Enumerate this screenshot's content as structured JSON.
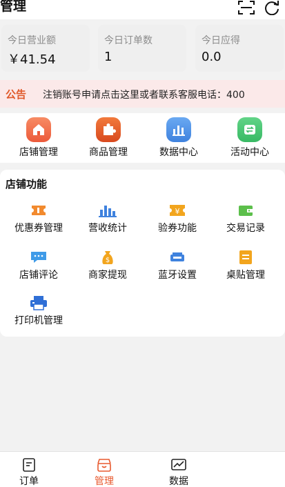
{
  "header": {
    "title": "管理",
    "scan_icon": "scan-icon",
    "refresh_icon": "refresh-icon"
  },
  "stats": [
    {
      "label": "今日营业额",
      "value": "￥41.54"
    },
    {
      "label": "今日订单数",
      "value": "1"
    },
    {
      "label": "今日应得",
      "value": "0.0"
    }
  ],
  "notice": {
    "label": "公告",
    "text": "注销账号申请点击这里或者联系客服电话：400"
  },
  "quick_actions": [
    {
      "label": "店铺管理",
      "icon": "store-icon",
      "color": "#f0764f"
    },
    {
      "label": "商品管理",
      "icon": "puzzle-icon",
      "color": "#e8592e"
    },
    {
      "label": "数据中心",
      "icon": "bar-chart-icon",
      "color": "#4a90e2"
    },
    {
      "label": "活动中心",
      "icon": "exchange-icon",
      "color": "#43c36c"
    }
  ],
  "store_functions": {
    "title": "店铺功能",
    "items": [
      {
        "label": "优惠券管理",
        "icon": "coupon-icon"
      },
      {
        "label": "营收统计",
        "icon": "bar-chart-icon"
      },
      {
        "label": "验券功能",
        "icon": "ticket-yen-icon"
      },
      {
        "label": "交易记录",
        "icon": "wallet-icon"
      },
      {
        "label": "店铺评论",
        "icon": "comment-icon"
      },
      {
        "label": "商家提现",
        "icon": "money-bag-icon"
      },
      {
        "label": "蓝牙设置",
        "icon": "bluetooth-device-icon"
      },
      {
        "label": "桌贴管理",
        "icon": "table-sticker-icon"
      },
      {
        "label": "打印机管理",
        "icon": "printer-icon"
      }
    ]
  },
  "bottom_nav": [
    {
      "label": "订单",
      "icon": "orders-icon",
      "active": false
    },
    {
      "label": "管理",
      "icon": "manage-icon",
      "active": true
    },
    {
      "label": "数据",
      "icon": "data-icon",
      "active": false
    }
  ],
  "colors": {
    "accent": "#e8592e",
    "notice_bg": "#fbe9e9"
  }
}
